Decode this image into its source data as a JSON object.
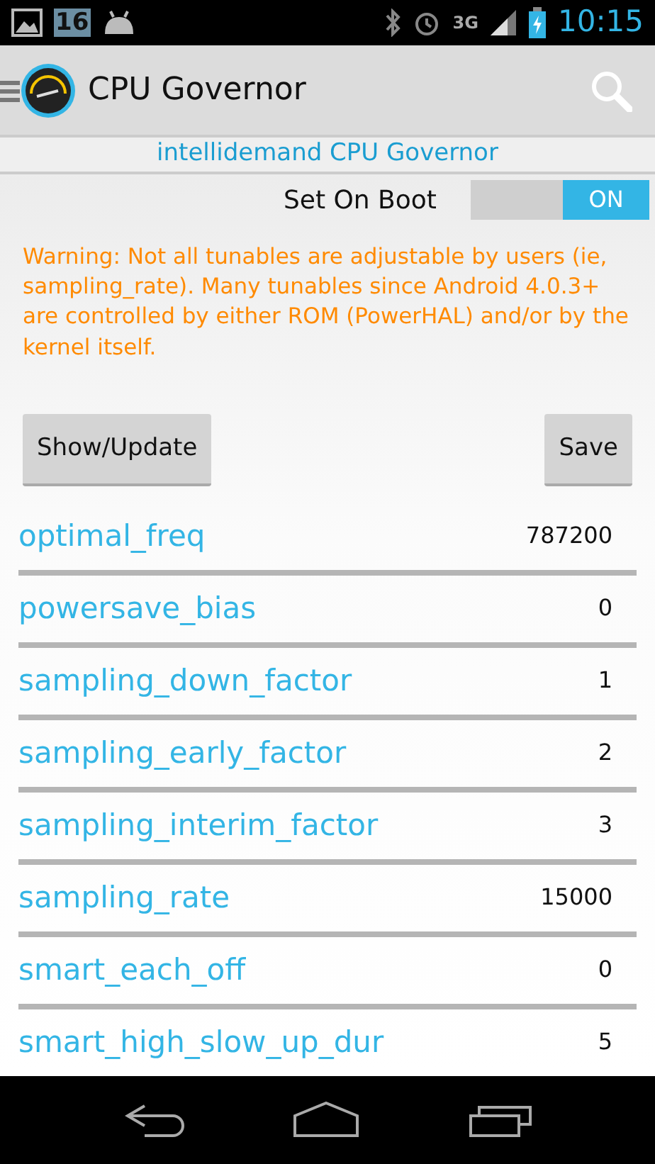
{
  "status_bar": {
    "date_badge": "16",
    "network": "3G",
    "time": "10:15"
  },
  "app_bar": {
    "title": "CPU Governor"
  },
  "governor_title": "intellidemand CPU Governor",
  "set_on_boot": {
    "label": "Set On Boot",
    "on": true,
    "state_text": "ON"
  },
  "warning": "Warning: Not all tunables are adjustable by users (ie, sampling_rate). Many tunables since Android 4.0.3+ are controlled by either ROM (PowerHAL) and/or by the kernel itself.",
  "buttons": [
    "Show/Update",
    "Save"
  ],
  "tunables": [
    {
      "name": "optimal_freq",
      "value": "787200"
    },
    {
      "name": "powersave_bias",
      "value": "0"
    },
    {
      "name": "sampling_down_factor",
      "value": "1"
    },
    {
      "name": "sampling_early_factor",
      "value": "2"
    },
    {
      "name": "sampling_interim_factor",
      "value": "3"
    },
    {
      "name": "sampling_rate",
      "value": "15000"
    },
    {
      "name": "smart_each_off",
      "value": "0"
    },
    {
      "name": "smart_high_slow_up_dur",
      "value": "5"
    }
  ]
}
